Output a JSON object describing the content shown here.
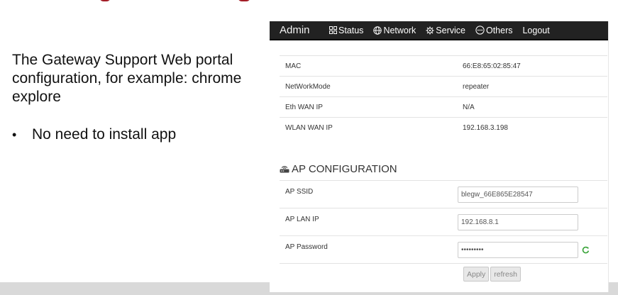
{
  "slide": {
    "description": "The Gateway Support Web portal configuration, for example: chrome explore",
    "bullet": "No need to install app",
    "bullet_mark": "•"
  },
  "portal": {
    "brand": "Admin",
    "nav": [
      {
        "label": "Status",
        "icon": "grid-icon"
      },
      {
        "label": "Network",
        "icon": "globe-icon"
      },
      {
        "label": "Service",
        "icon": "gear-icon"
      },
      {
        "label": "Others",
        "icon": "ellipsis-icon"
      },
      {
        "label": "Logout",
        "icon": ""
      }
    ],
    "status": [
      {
        "key": "MAC",
        "value": "66:E8:65:02:85:47"
      },
      {
        "key": "NetWorkMode",
        "value": "repeater"
      },
      {
        "key": "Eth WAN IP",
        "value": "N/A"
      },
      {
        "key": "WLAN WAN IP",
        "value": "192.168.3.198"
      }
    ],
    "ap_section_title": "AP CONFIGURATION",
    "ap_section_icon": "router-icon",
    "ap_fields": [
      {
        "label": "AP SSID",
        "value": "blegw_66E865E28547"
      },
      {
        "label": "AP LAN IP",
        "value": "192.168.8.1"
      },
      {
        "label": "AP Password",
        "value": "•••••••••"
      }
    ],
    "buttons": {
      "apply": "Apply",
      "refresh": "refresh"
    },
    "colors": {
      "navbar": "#222222",
      "accent_green": "#3aa43a",
      "title_red": "#a31c26"
    }
  }
}
